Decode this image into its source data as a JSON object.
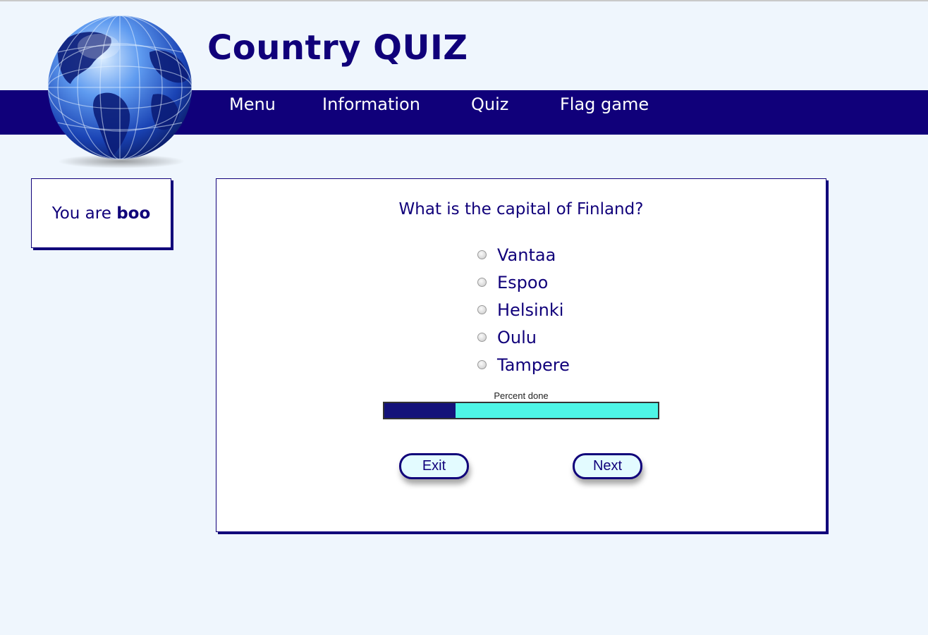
{
  "site": {
    "title": "Country QUIZ",
    "logo": "globe-logo"
  },
  "nav": {
    "items": [
      {
        "label": "Menu"
      },
      {
        "label": "Information"
      },
      {
        "label": "Quiz"
      },
      {
        "label": "Flag game"
      }
    ]
  },
  "user": {
    "prefix": "You are ",
    "name": "boo"
  },
  "quiz": {
    "question": "What is the capital of Finland?",
    "options": [
      "Vantaa",
      "Espoo",
      "Helsinki",
      "Oulu",
      "Tampere"
    ],
    "progress": {
      "label": "Percent done",
      "percent": 26
    },
    "buttons": {
      "exit": "Exit",
      "next": "Next"
    }
  },
  "colors": {
    "brand": "#10007a",
    "background": "#eff6fd",
    "progress_fill": "#14127a",
    "progress_track": "#4ef5e6"
  }
}
